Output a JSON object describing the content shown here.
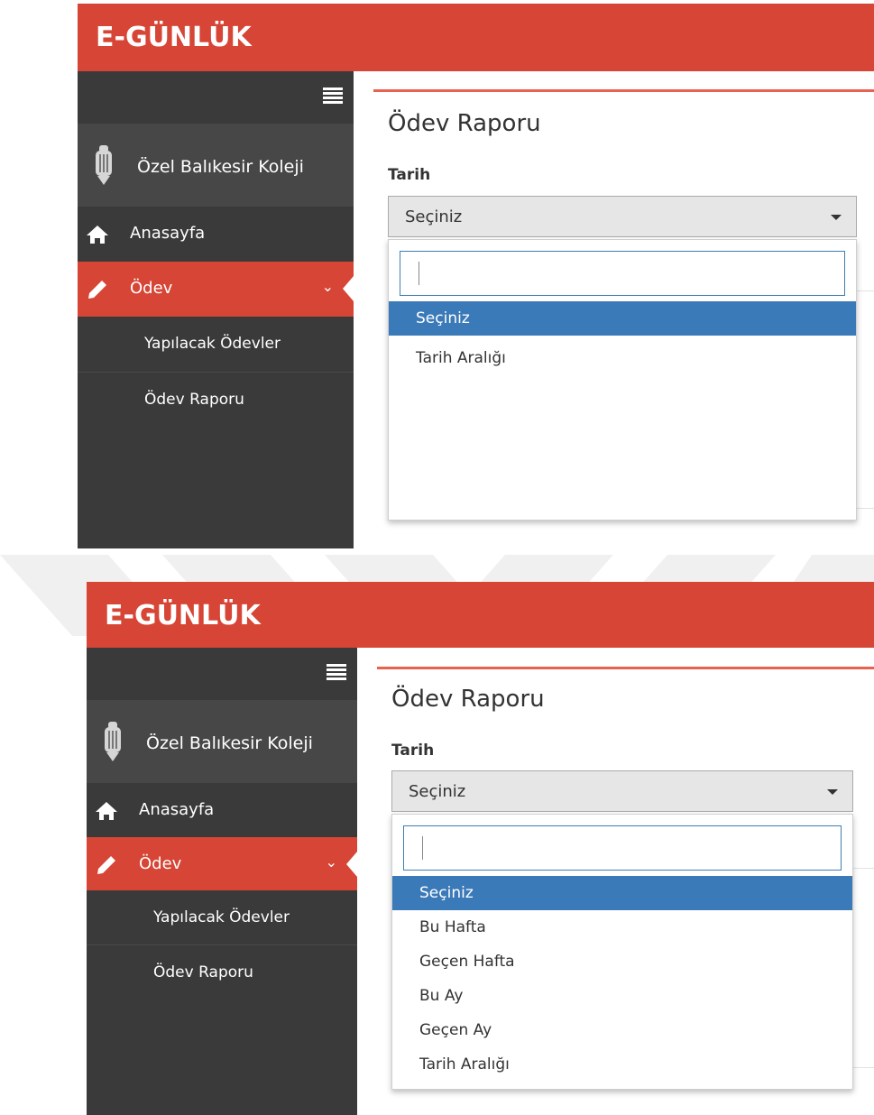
{
  "app": {
    "logo_text": "E-GÜNLÜK"
  },
  "sidebar": {
    "school_name": "Özel Balıkesir Koleji",
    "items": [
      {
        "label": "Anasayfa",
        "icon": "home-icon"
      },
      {
        "label": "Ödev",
        "icon": "pencil-icon",
        "active": true
      }
    ],
    "subitems": [
      {
        "label": "Yapılacak Ödevler"
      },
      {
        "label": "Ödev Raporu"
      }
    ]
  },
  "panel": {
    "title": "Ödev Raporu",
    "field_label": "Tarih",
    "selected_value": "Seçiniz"
  },
  "dropdowns": [
    {
      "options": [
        "Seçiniz",
        "Tarih Aralığı"
      ],
      "selected": "Seçiniz"
    },
    {
      "options": [
        "Seçiniz",
        "Bu Hafta",
        "Geçen Hafta",
        "Bu Ay",
        "Geçen Ay",
        "Tarih Aralığı"
      ],
      "selected": "Seçiniz"
    }
  ],
  "colors": {
    "brand": "#d64535",
    "sidebar": "#3a3a3a",
    "highlight": "#3b7ab8",
    "panel_accent": "#e8624f"
  }
}
